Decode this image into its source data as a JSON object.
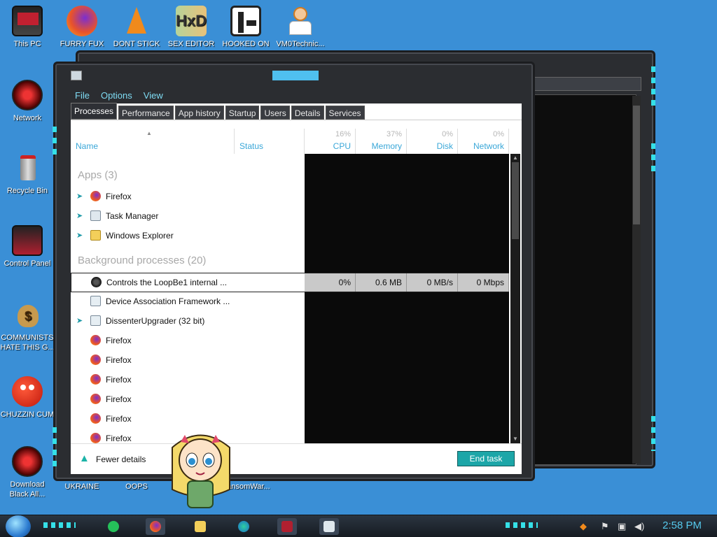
{
  "desktop": {
    "icons": [
      {
        "label": "This PC",
        "icon": "monitor-icon"
      },
      {
        "label": "FURRY FUX",
        "icon": "firefox-icon"
      },
      {
        "label": "DONT STICK",
        "icon": "vlc-icon"
      },
      {
        "label": "SEX EDITOR",
        "icon": "hxd-icon"
      },
      {
        "label": "HOOKED ON",
        "icon": "game-icon"
      },
      {
        "label": "VM0Technic...",
        "icon": "doctor-icon"
      },
      {
        "label": "Network",
        "icon": "network-icon"
      },
      {
        "label": "Recycle Bin",
        "icon": "recycle-bin-icon"
      },
      {
        "label": "Control Panel",
        "icon": "control-panel-icon"
      },
      {
        "label": "COMMUNISTS HATE THIS G...",
        "icon": "money-bag-icon"
      },
      {
        "label": "CHUZZIN CUM",
        "icon": "chuzzle-icon"
      },
      {
        "label": "Download Black All...",
        "icon": "download-icon"
      },
      {
        "label": "UKRAINE",
        "icon": "file-icon"
      },
      {
        "label": "OOPS",
        "icon": "file-icon"
      },
      {
        "label": "RansomWar...",
        "icon": "file-icon"
      }
    ]
  },
  "taskmanager": {
    "menu": [
      "File",
      "Options",
      "View"
    ],
    "tabs": [
      "Processes",
      "Performance",
      "App history",
      "Startup",
      "Users",
      "Details",
      "Services"
    ],
    "active_tab": "Processes",
    "columns": {
      "name": "Name",
      "status": "Status",
      "cpu": {
        "label": "CPU",
        "pct": "16%"
      },
      "memory": {
        "label": "Memory",
        "pct": "37%"
      },
      "disk": {
        "label": "Disk",
        "pct": "0%"
      },
      "network": {
        "label": "Network",
        "pct": "0%"
      }
    },
    "groups": {
      "apps": "Apps (3)",
      "background": "Background processes (20)"
    },
    "apps": [
      {
        "name": "Firefox",
        "icon": "firefox-icon",
        "expandable": true
      },
      {
        "name": "Task Manager",
        "icon": "task-manager-icon",
        "expandable": true
      },
      {
        "name": "Windows Explorer",
        "icon": "folder-icon",
        "expandable": true
      }
    ],
    "background": [
      {
        "name": "Controls the LoopBe1 internal ...",
        "icon": "loopbe-icon",
        "expandable": false,
        "selected": true,
        "cpu": "0%",
        "memory": "0.6 MB",
        "disk": "0 MB/s",
        "network": "0 Mbps"
      },
      {
        "name": "Device Association Framework ...",
        "icon": "service-icon",
        "expandable": false
      },
      {
        "name": "DissenterUpgrader (32 bit)",
        "icon": "service-icon",
        "expandable": true
      },
      {
        "name": "Firefox",
        "icon": "firefox-icon",
        "expandable": false
      },
      {
        "name": "Firefox",
        "icon": "firefox-icon",
        "expandable": false
      },
      {
        "name": "Firefox",
        "icon": "firefox-icon",
        "expandable": false
      },
      {
        "name": "Firefox",
        "icon": "firefox-icon",
        "expandable": false
      },
      {
        "name": "Firefox",
        "icon": "firefox-icon",
        "expandable": false
      },
      {
        "name": "Firefox",
        "icon": "firefox-icon",
        "expandable": false
      }
    ],
    "footer": {
      "fewer_details": "Fewer details",
      "end_task": "End task"
    }
  },
  "taskbar": {
    "clock": "2:58 PM",
    "pinned": [
      "steam-icon",
      "firefox-icon",
      "file-explorer-icon",
      "edge-icon",
      "game-icon",
      "task-manager-icon"
    ]
  },
  "colors": {
    "accent": "#1ca6a8",
    "menu_text": "#7fdcf4",
    "desktop": "#3a8fd6"
  }
}
